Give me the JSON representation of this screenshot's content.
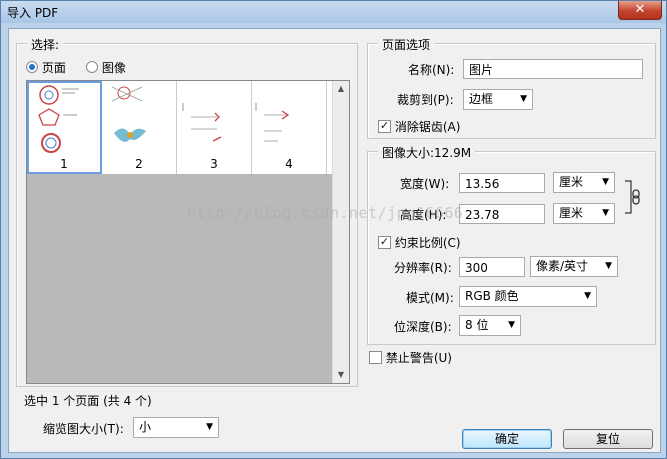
{
  "window": {
    "title": "导入 PDF",
    "close_label": "✕"
  },
  "select_group": {
    "legend": "选择:",
    "radio_pages": "页面",
    "radio_images": "图像",
    "selected_mode": "pages",
    "thumbnails": [
      {
        "label": "1",
        "selected": true
      },
      {
        "label": "2",
        "selected": false
      },
      {
        "label": "3",
        "selected": false
      },
      {
        "label": "4",
        "selected": false
      }
    ],
    "status": "选中 1 个页面 (共 4 个)",
    "thumb_size_label": "缩览图大小(T):",
    "thumb_size_value": "小"
  },
  "page_options": {
    "legend": "页面选项",
    "name_label": "名称(N):",
    "name_value": "图片",
    "crop_label": "裁剪到(P):",
    "crop_value": "边框",
    "antialias_label": "消除锯齿(A)",
    "antialias_checked": true
  },
  "image_size": {
    "legend": "图像大小:12.9M",
    "width_label": "宽度(W):",
    "width_value": "13.56",
    "width_unit": "厘米",
    "height_label": "高度(H):",
    "height_value": "23.78",
    "height_unit": "厘米",
    "constrain_label": "约束比例(C)",
    "constrain_checked": true,
    "resolution_label": "分辨率(R):",
    "resolution_value": "300",
    "resolution_unit": "像素/英寸",
    "mode_label": "模式(M):",
    "mode_value": "RGB 颜色",
    "depth_label": "位深度(B):",
    "depth_value": "8 位"
  },
  "suppress_warnings_label": "禁止警告(U)",
  "buttons": {
    "ok": "确定",
    "reset": "复位"
  },
  "watermark": "http://blog.csdn.net/jpg16666"
}
